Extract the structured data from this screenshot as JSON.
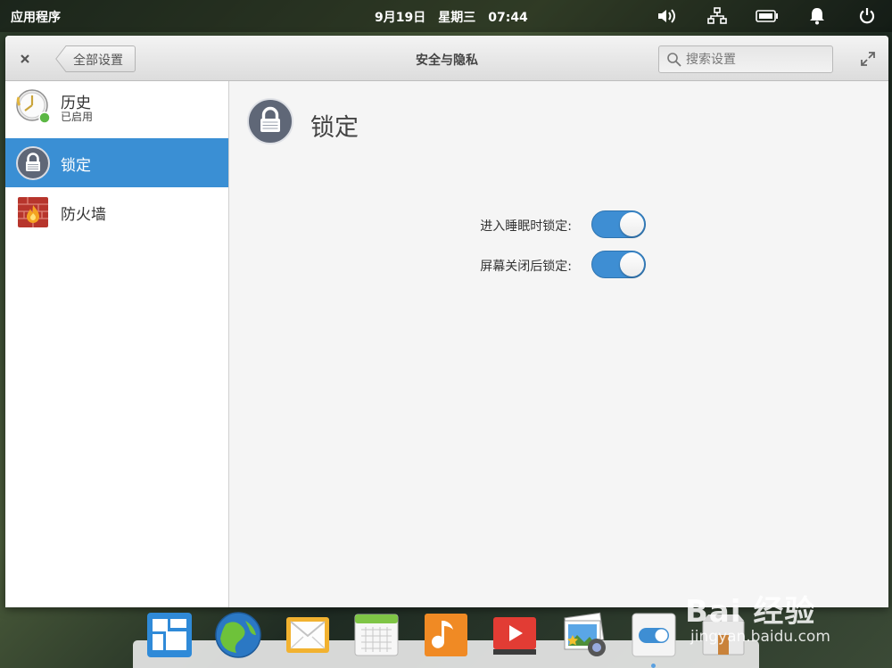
{
  "top_panel": {
    "applications": "应用程序",
    "date": "9月19日",
    "weekday": "星期三",
    "time": "07:44",
    "tray_icons": [
      "volume-icon",
      "network-icon",
      "battery-icon",
      "notification-bell-icon",
      "power-icon"
    ]
  },
  "window": {
    "title": "安全与隐私",
    "back_label": "全部设置",
    "search_placeholder": "搜索设置"
  },
  "sidebar": {
    "items": [
      {
        "name": "历史",
        "subtitle": "已启用",
        "icon": "clock-history-icon",
        "active": false
      },
      {
        "name": "锁定",
        "icon": "lock-icon",
        "active": true
      },
      {
        "name": "防火墙",
        "icon": "firewall-icon",
        "active": false
      }
    ]
  },
  "pane": {
    "title": "锁定",
    "settings": [
      {
        "label": "进入睡眠时锁定:",
        "enabled": true
      },
      {
        "label": "屏幕关闭后锁定:",
        "enabled": true
      }
    ]
  },
  "dock": {
    "items": [
      "multitasking-view-icon",
      "web-browser-icon",
      "mail-icon",
      "calendar-icon",
      "music-icon",
      "videos-icon",
      "photos-icon",
      "system-settings-icon",
      "app-center-icon"
    ]
  },
  "watermark": {
    "brand": "Bai 经验",
    "url": "jingyan.baidu.com"
  },
  "colors": {
    "accent": "#3a8fd4",
    "switch_on": "#3e8ed3"
  }
}
